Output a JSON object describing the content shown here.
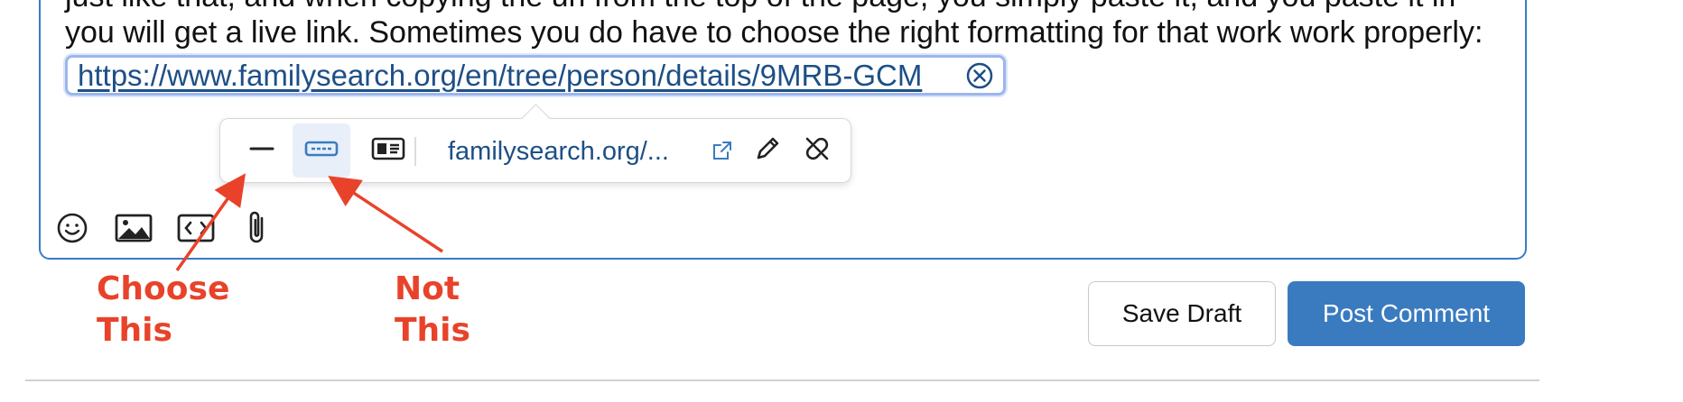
{
  "editor": {
    "cut_line": "just like that, and when copying the url from the top of the page, you simply paste it, and you paste it in",
    "line2": "you will get a live link. Sometimes you do have to choose the right formatting for that work work properly:",
    "link_url": "https://www.familysearch.org/en/tree/person/details/9MRB-GCM"
  },
  "link_toolbar": {
    "url_preview": "familysearch.org/...",
    "icons": [
      "plain-text-icon",
      "inline-card-icon",
      "block-card-icon",
      "external-link-icon",
      "edit-pencil-icon",
      "unlink-icon"
    ]
  },
  "editor_toolbar": {
    "icons": [
      "emoji-icon",
      "image-icon",
      "code-icon",
      "attachment-icon"
    ]
  },
  "annotations": {
    "choose": "Choose\nThis",
    "not": "Not\nThis",
    "color": "#e8432a"
  },
  "actions": {
    "save_draft": "Save Draft",
    "post_comment": "Post Comment"
  },
  "colors": {
    "accent": "#3a7bc0",
    "link": "#1d4f86",
    "annotation": "#e8432a"
  }
}
